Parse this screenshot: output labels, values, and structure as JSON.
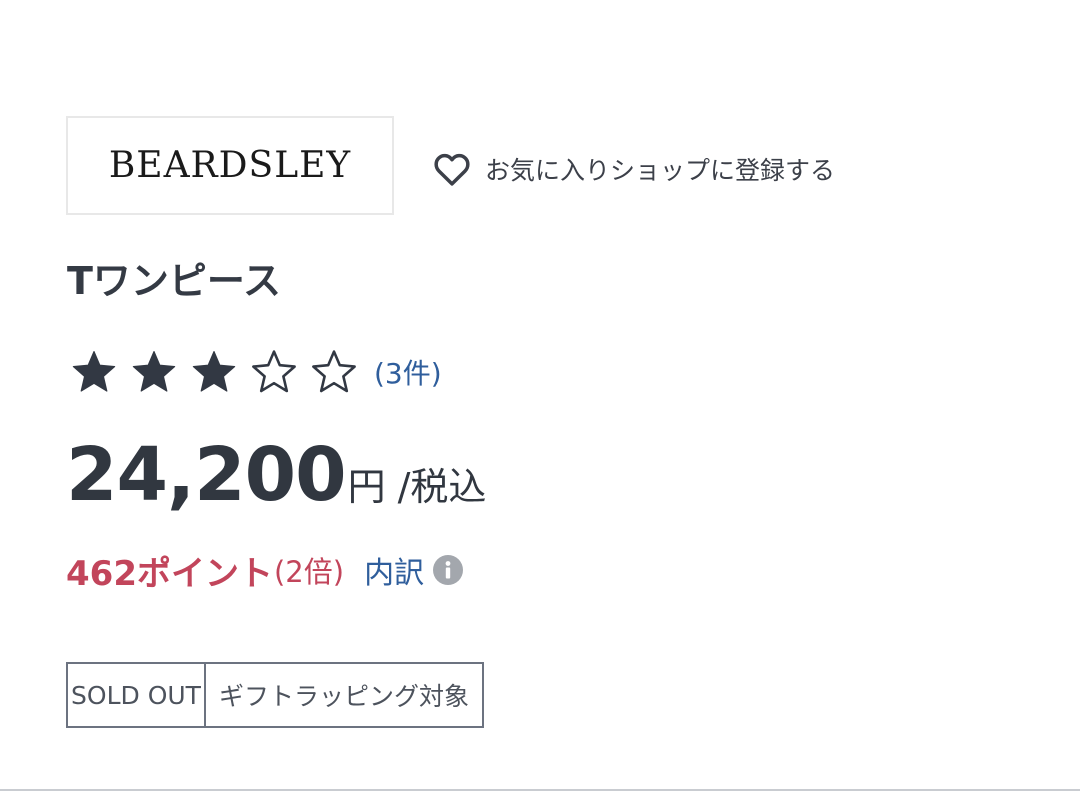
{
  "shop": {
    "logo_text": "BEARDSLEY",
    "favorite_label": "お気に入りショップに登録する"
  },
  "product": {
    "name": "Tワンピース"
  },
  "rating": {
    "value": 3,
    "max": 5,
    "count_label": "(3件)"
  },
  "price": {
    "amount": "24,200",
    "currency": "円",
    "tax_label": "/税込"
  },
  "points": {
    "value_label": "462ポイント",
    "multiplier_label": "(2倍)",
    "breakdown_label": "内訳"
  },
  "tags": [
    "SOLD OUT",
    "ギフトラッピング対象"
  ],
  "colors": {
    "text": "#333a45",
    "link": "#2f5e9c",
    "points": "#c2455b",
    "star": "#323843",
    "border": "#6c7380"
  },
  "icons": {
    "favorite": "heart-outline-icon",
    "star_full": "star-filled-icon",
    "star_empty": "star-outline-icon",
    "info": "info-circle-icon"
  }
}
